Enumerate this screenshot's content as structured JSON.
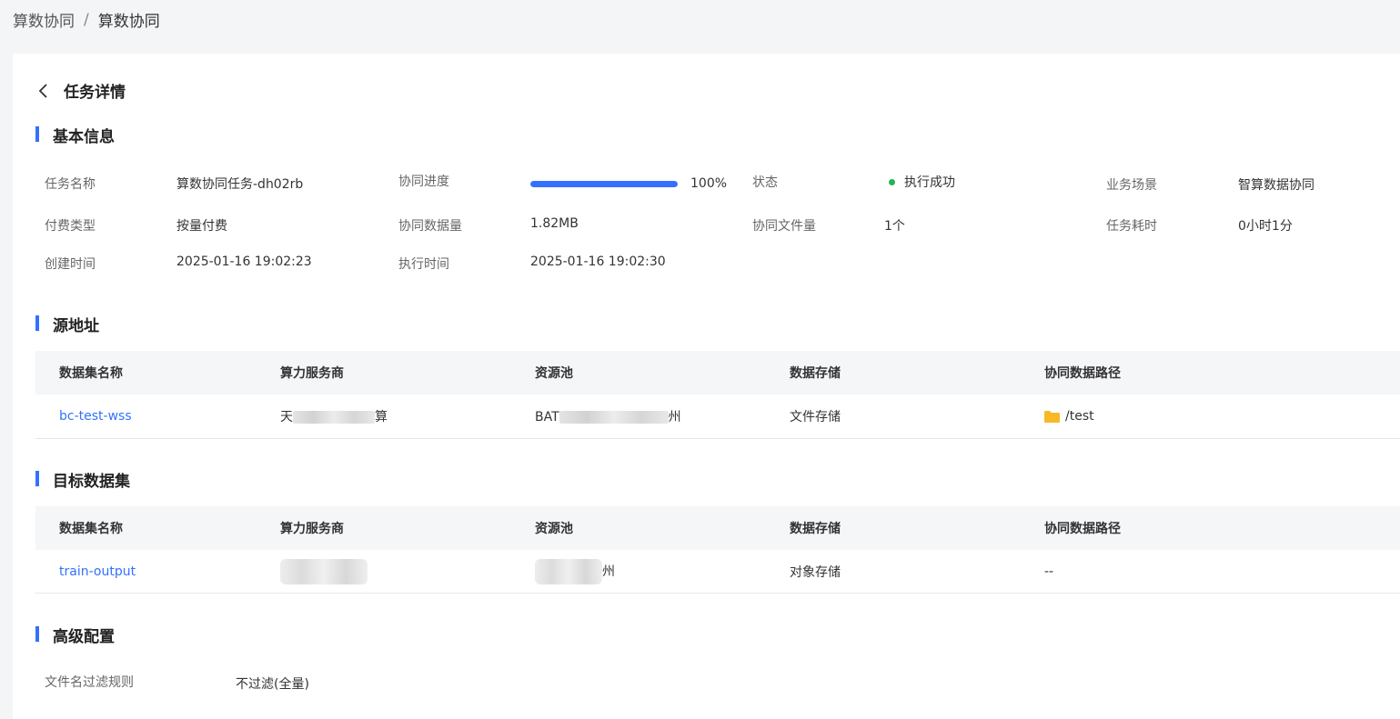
{
  "breadcrumb": {
    "parent": "算数协同",
    "separator": "/",
    "current": "算数协同"
  },
  "page": {
    "title": "任务详情"
  },
  "sections": {
    "basic": "基本信息",
    "source": "源地址",
    "target": "目标数据集",
    "advanced": "高级配置"
  },
  "basic_info": {
    "task_name_label": "任务名称",
    "task_name": "算数协同任务-dh02rb",
    "progress_label": "协同进度",
    "progress_percent": 100,
    "progress_text": "100%",
    "status_label": "状态",
    "status": "执行成功",
    "status_color": "#22b455",
    "scene_label": "业务场景",
    "scene": "智算数据协同",
    "pay_label": "付费类型",
    "pay": "按量付费",
    "data_size_label": "协同数据量",
    "data_size": "1.82MB",
    "file_count_label": "协同文件量",
    "file_count": "1个",
    "duration_label": "任务耗时",
    "duration": "0小时1分",
    "created_label": "创建时间",
    "created": "2025-01-16 19:02:23",
    "exec_label": "执行时间",
    "exec": "2025-01-16 19:02:30"
  },
  "table_headers": [
    "数据集名称",
    "算力服务商",
    "资源池",
    "数据存储",
    "协同数据路径"
  ],
  "source_rows": [
    {
      "dataset": "bc-test-wss",
      "provider_start": "天",
      "provider_end": "算",
      "pool_start": "BAT",
      "pool_end": "州",
      "storage": "文件存储",
      "path": "/test"
    }
  ],
  "target_rows": [
    {
      "dataset": "train-output",
      "pool_end": "州",
      "storage": "对象存储",
      "path": "--"
    }
  ],
  "advanced": {
    "filter_label": "文件名过滤规则",
    "filter_value": "不过滤(全量)"
  },
  "colors": {
    "accent": "#3370ff",
    "folder": "#f7b928"
  }
}
